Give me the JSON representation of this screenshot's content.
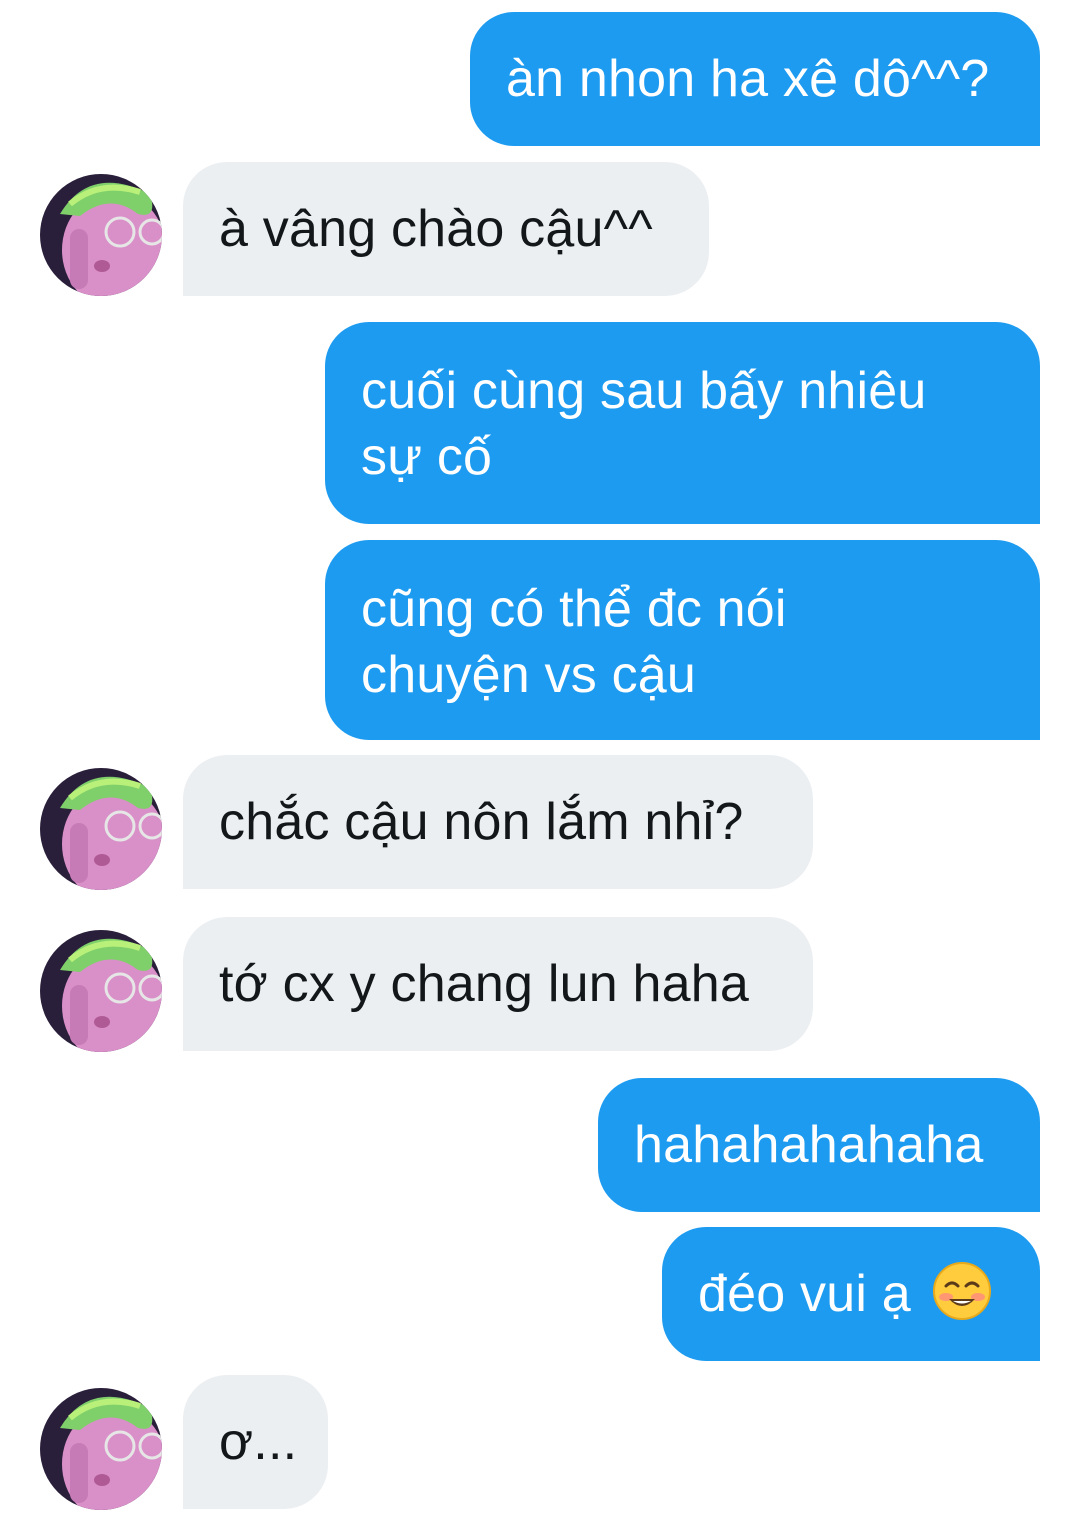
{
  "conversation": {
    "messages": [
      {
        "side": "out",
        "text": "àn nhon ha xê dô^^?"
      },
      {
        "side": "in",
        "text": "à vâng chào cậu^^"
      },
      {
        "side": "out",
        "text": "cuối cùng sau bấy nhiêu\nsự cố"
      },
      {
        "side": "out",
        "text": "cũng có thể đc nói\nchuyện vs cậu"
      },
      {
        "side": "in",
        "text": "chắc cậu nôn lắm nhỉ?"
      },
      {
        "side": "in",
        "text": "tớ cx y chang lun haha"
      },
      {
        "side": "out",
        "text": "hahahahahaha"
      },
      {
        "side": "out",
        "text": "đéo vui ạ",
        "emoji": "smiling-blush-emoji"
      },
      {
        "side": "in",
        "text": "ơ..."
      }
    ]
  },
  "colors": {
    "outgoing_bubble": "#1d9bf0",
    "incoming_bubble": "#eceff2",
    "outgoing_text": "#ffffff",
    "incoming_text": "#14171a"
  },
  "icons": {
    "avatar": "contact-avatar-photo",
    "emoji": "smiling-face-with-blush"
  }
}
